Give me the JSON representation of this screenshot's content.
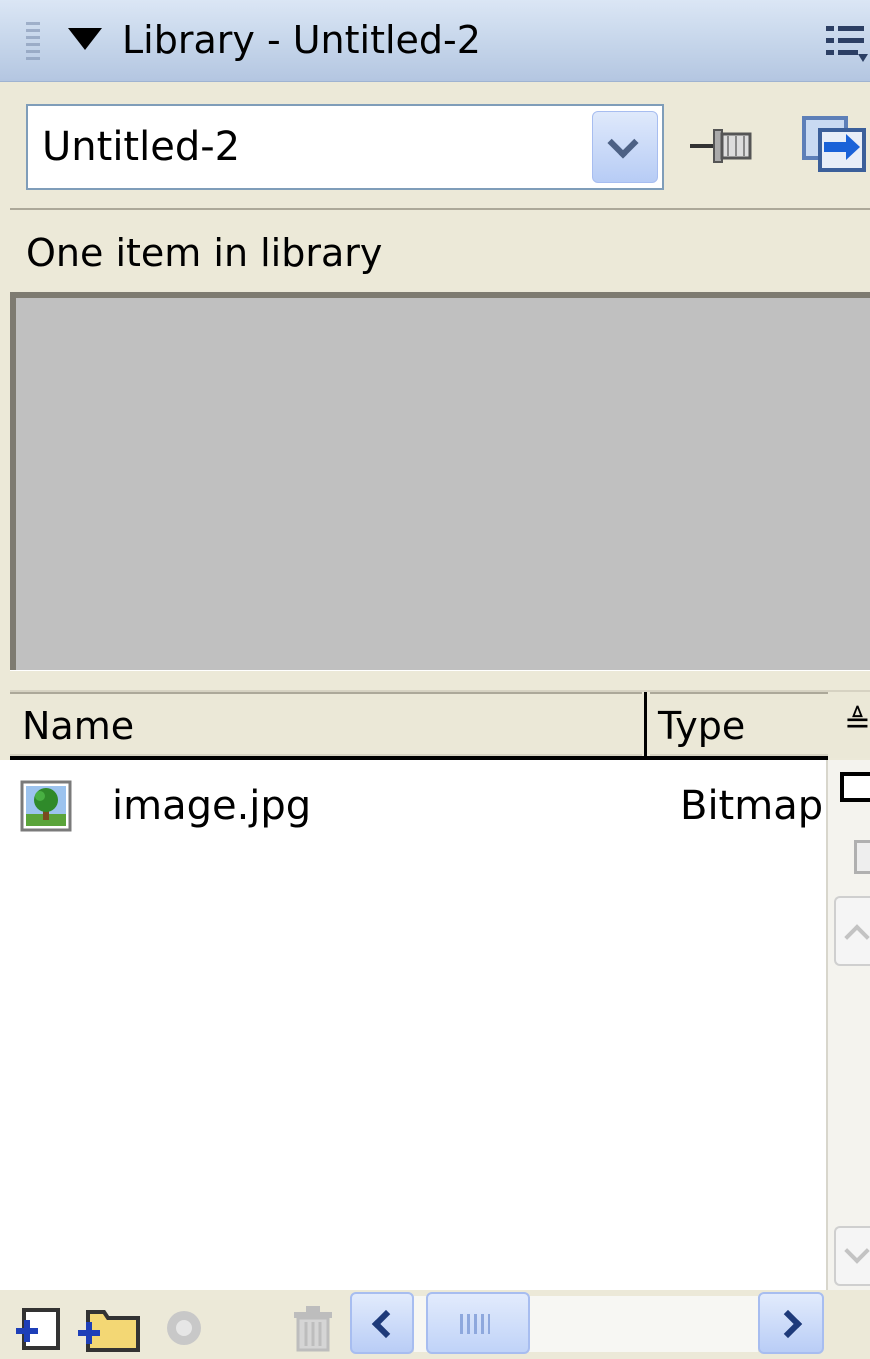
{
  "panel": {
    "title": "Library - Untitled-2",
    "options_icon": "options-menu-icon"
  },
  "toolbar": {
    "document_select_value": "Untitled-2",
    "pin_icon": "pin-library-icon",
    "goto_icon": "go-to-document-icon"
  },
  "library": {
    "count_text": "One item in library"
  },
  "columns": {
    "name": "Name",
    "type": "Type",
    "sort_icon": "sort-order-icon"
  },
  "items": [
    {
      "name": "image.jpg",
      "type": "Bitmap",
      "icon": "bitmap-icon"
    }
  ],
  "bottom_bar": {
    "icons": [
      "new-symbol-icon",
      "new-folder-icon",
      "properties-icon",
      "delete-icon"
    ]
  },
  "colors": {
    "titlebar": "#c5d5ea",
    "panel_bg": "#ece9d8",
    "preview_bg": "#c0c0c0",
    "scroll_accent": "#a7bdf0"
  }
}
